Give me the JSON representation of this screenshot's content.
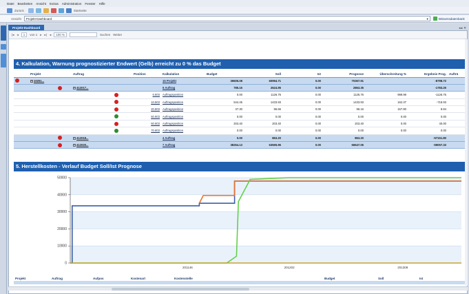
{
  "menu": [
    "Datei",
    "Bearbeiten",
    "Ansicht",
    "Extras",
    "Administration",
    "Fenster",
    "Hilfe"
  ],
  "toolbar": {
    "back": "Zurück",
    "view": "Startseite"
  },
  "address": {
    "label": "Ansicht",
    "value": "Projekt-Dashboard",
    "wiki": "Wissensdatenbank"
  },
  "tab": {
    "label": "Projekt-Dashboard"
  },
  "report_bar": {
    "page_of": "von 1",
    "page": "1",
    "zoom": "100 %",
    "search": "Suchen",
    "next": "Weiter"
  },
  "section4": {
    "title": "4. Kalkulation, Warnung prognostizierter Endwert (Gelb) erreicht zu 0 % das Budget",
    "columns": [
      "Projekt",
      "Auftrag",
      "Position",
      "Kalkulation",
      "Budget",
      "Soll",
      "Ist",
      "Prognose",
      "Überschreitung %",
      "Ergebnis Prog.",
      "Aufträ"
    ],
    "rows": [
      {
        "status": "red",
        "projekt": "10251...",
        "auftrag": "",
        "pos_status": "",
        "position": "",
        "kalk": "15 Projekt",
        "budget": "39605.08",
        "soll": "60994.71",
        "ist": "0.00",
        "prognose": "70367.91",
        "ueber": "",
        "ergebnis": "-8798.72",
        "sum": true
      },
      {
        "status": "",
        "projekt": "",
        "auftrag": "412017...",
        "auf_status": "red",
        "pos_status": "",
        "position": "",
        "kalk": "6 Auftrag",
        "budget": "785.15",
        "soll": "2624.95",
        "ist": "0.00",
        "prognose": "2863.35",
        "ueber": "",
        "ergebnis": "-1783.25",
        "sum": true
      },
      {
        "projekt": "",
        "auftrag": "",
        "pos_status": "red",
        "position": "6.803",
        "kalk": "Auftragsposition",
        "budget": "0.00",
        "soll": "1126.76",
        "ist": "0.00",
        "prognose": "1126.76",
        "ueber": "999.99",
        "ergebnis": "-1126.76"
      },
      {
        "projekt": "",
        "auftrag": "",
        "pos_status": "red",
        "position": "10.803",
        "kalk": "Auftragsposition",
        "budget": "544.45",
        "soll": "1433.93",
        "ist": "0.00",
        "prognose": "1433.93",
        "ueber": "162.37",
        "ergebnis": "-718.93"
      },
      {
        "projekt": "",
        "auftrag": "",
        "pos_status": "red",
        "position": "20.803",
        "kalk": "Auftragsposition",
        "budget": "37.30",
        "soll": "96.66",
        "ist": "0.00",
        "prognose": "96.16",
        "ueber": "157.80",
        "ergebnis": "8.84"
      },
      {
        "projekt": "",
        "auftrag": "",
        "pos_status": "green",
        "position": "50.803",
        "kalk": "Auftragsposition",
        "budget": "0.00",
        "soll": "0.00",
        "ist": "0.00",
        "prognose": "0.00",
        "ueber": "0.00",
        "ergebnis": "0.00"
      },
      {
        "projekt": "",
        "auftrag": "",
        "pos_status": "red",
        "position": "60.803",
        "kalk": "Auftragsposition",
        "budget": "203.40",
        "soll": "203.40",
        "ist": "0.00",
        "prognose": "203.40",
        "ueber": "0.00",
        "ergebnis": "40.00"
      },
      {
        "projekt": "",
        "auftrag": "",
        "pos_status": "green",
        "position": "70.803",
        "kalk": "Auftragsposition",
        "budget": "0.00",
        "soll": "0.00",
        "ist": "0.00",
        "prognose": "0.00",
        "ueber": "0.00",
        "ergebnis": "0.00"
      },
      {
        "projekt": "",
        "auftrag": "412018...",
        "auf_status": "red",
        "pos_status": "",
        "position": "",
        "kalk": "4 Auftrag",
        "budget": "0.00",
        "soll": "863.20",
        "ist": "0.00",
        "prognose": "863.20",
        "ueber": "",
        "ergebnis": "-57151.80",
        "sum": true
      },
      {
        "projekt": "",
        "auftrag": "412020...",
        "auf_status": "red",
        "pos_status": "",
        "position": "",
        "kalk": "7 Auftrag",
        "budget": "38264.13",
        "soll": "63565.96",
        "ist": "0.00",
        "prognose": "66647.06",
        "ueber": "",
        "ergebnis": "-59067.33",
        "sum": true
      }
    ]
  },
  "section5": {
    "title": "5. Herstellkosten - Verlauf Budget Soll/Ist Prognose"
  },
  "chart_data": {
    "type": "line",
    "x_ticks": [
      "201146",
      "201202",
      "201308"
    ],
    "ylim": [
      0,
      50000
    ],
    "y_ticks": [
      0,
      10000,
      20000,
      30000,
      40000,
      50000
    ],
    "grid": true,
    "series": [
      {
        "color": "#3a5fa8",
        "points": [
          [
            0,
            0
          ],
          [
            0.5,
            0
          ],
          [
            0.5,
            33500
          ],
          [
            33,
            33500
          ],
          [
            33,
            35000
          ],
          [
            42,
            35000
          ],
          [
            42,
            48000
          ],
          [
            100,
            48000
          ]
        ]
      },
      {
        "color": "#e8702a",
        "points": [
          [
            33,
            35000
          ],
          [
            34,
            39500
          ],
          [
            42,
            39500
          ],
          [
            42,
            48000
          ],
          [
            100,
            48000
          ]
        ]
      },
      {
        "color": "#62d04a",
        "points": [
          [
            0,
            0
          ],
          [
            40,
            0
          ],
          [
            42.5,
            4000
          ],
          [
            43,
            36000
          ],
          [
            46,
            49000
          ],
          [
            56,
            50000
          ],
          [
            100,
            50000
          ]
        ]
      },
      {
        "color": "#caa22b",
        "points": [
          [
            0,
            0
          ],
          [
            100,
            0
          ]
        ]
      }
    ]
  },
  "footer": {
    "columns": [
      "Projekt",
      "Auftrag",
      "Aufpos",
      "Kostenart",
      "Kostenstelle",
      "Budget",
      "Soll",
      "Ist"
    ]
  }
}
